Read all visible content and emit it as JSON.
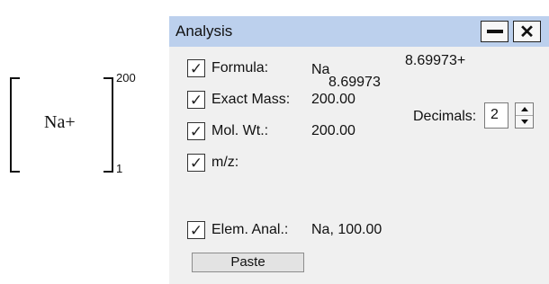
{
  "structure": {
    "species": "Na+",
    "repeat_upper": "200",
    "repeat_lower": "1"
  },
  "window": {
    "title": "Analysis",
    "minimize_symbol": "",
    "close_symbol": "✕"
  },
  "fields": {
    "formula": {
      "label": "Formula:",
      "element": "Na",
      "subscript": "8.69973",
      "superscript": "8.69973+",
      "checked": true
    },
    "exact_mass": {
      "label": "Exact Mass:",
      "value": "200.00",
      "checked": true
    },
    "mol_wt": {
      "label": "Mol. Wt.:",
      "value": "200.00",
      "checked": true
    },
    "mz": {
      "label": "m/z:",
      "value": "",
      "checked": true
    },
    "elem_anal": {
      "label": "Elem. Anal.:",
      "value": "Na, 100.00",
      "checked": true
    }
  },
  "decimals": {
    "label": "Decimals:",
    "value": "2"
  },
  "checkbox_mark": "✓",
  "paste_label": "Paste"
}
